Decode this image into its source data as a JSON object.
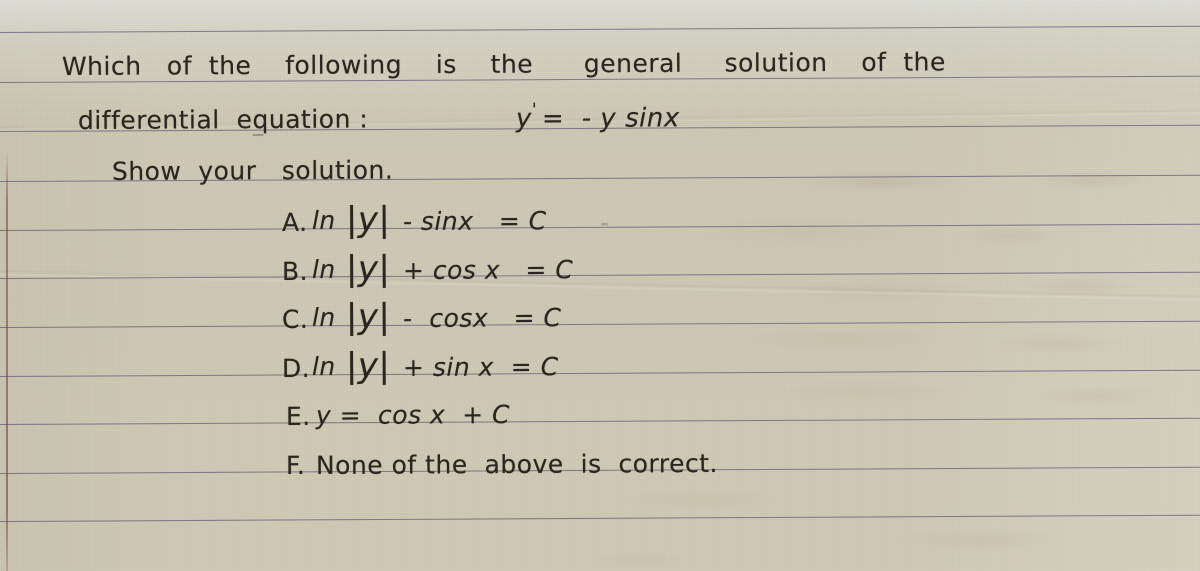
{
  "medium": "handwritten-notebook-page",
  "paper": {
    "background_color": "#cdc9b4",
    "rule_color": "#6b6880",
    "margin_rule_color": "#8c3c30",
    "ink_color": "#2a2520",
    "rule_y_positions": [
      32,
      82,
      131,
      181,
      230,
      278,
      327,
      376,
      424,
      473,
      521
    ]
  },
  "question": {
    "line1": "Which   of  the    following    is    the      general     solution    of  the",
    "line2_label": "differential  equation :",
    "line2_dash": "_",
    "line2_equation_lhs": "y",
    "line2_equation_prime": "'",
    "line2_equation_rhs": "=  - y sinx",
    "line3_instruction": "Show  your   solution."
  },
  "options": [
    {
      "letter": "A.",
      "expr_ln": "ln",
      "expr_abs": "|y|",
      "expr_rest": "- sinx   = C",
      "trailing_mark": "-"
    },
    {
      "letter": "B.",
      "expr_ln": "ln",
      "expr_abs": "|y|",
      "expr_rest": "+ cos x   = C",
      "trailing_mark": ""
    },
    {
      "letter": "C.",
      "expr_ln": "ln",
      "expr_abs": "|y|",
      "expr_rest": "-  cosx   = C",
      "trailing_mark": ""
    },
    {
      "letter": "D.",
      "expr_ln": "ln",
      "expr_abs": "|y|",
      "expr_rest": "+ sin x  = C",
      "trailing_mark": ""
    },
    {
      "letter": "E.",
      "expr_ln": "",
      "expr_abs": "",
      "expr_rest": "y =  cos x  + C",
      "trailing_mark": ""
    },
    {
      "letter": "F.",
      "expr_ln": "",
      "expr_abs": "",
      "expr_rest": "None of the  above  is  correct.",
      "trailing_mark": ""
    }
  ]
}
